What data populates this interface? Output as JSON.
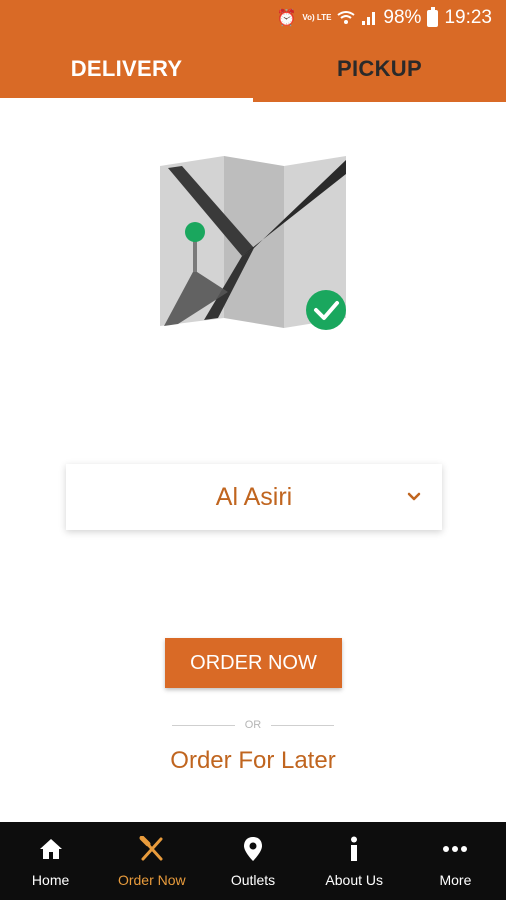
{
  "status_bar": {
    "battery_percent": "98%",
    "time": "19:23",
    "volte": "Vo) LTE"
  },
  "tabs": [
    {
      "label": "DELIVERY",
      "active": true
    },
    {
      "label": "PICKUP",
      "active": false
    }
  ],
  "location_select": {
    "selected": "Al Asiri"
  },
  "actions": {
    "order_now": "ORDER NOW",
    "separator": "OR",
    "order_later": "Order For Later"
  },
  "bottom_nav": [
    {
      "label": "Home",
      "icon": "home-icon",
      "active": false
    },
    {
      "label": "Order Now",
      "icon": "fork-knife-icon",
      "active": true
    },
    {
      "label": "Outlets",
      "icon": "location-pin-icon",
      "active": false
    },
    {
      "label": "About Us",
      "icon": "info-icon",
      "active": false
    },
    {
      "label": "More",
      "icon": "more-dots-icon",
      "active": false
    }
  ],
  "colors": {
    "brand_orange": "#d96a26",
    "text_orange": "#c0651f",
    "active_nav": "#e89b3c",
    "success_green": "#1aa75e"
  }
}
